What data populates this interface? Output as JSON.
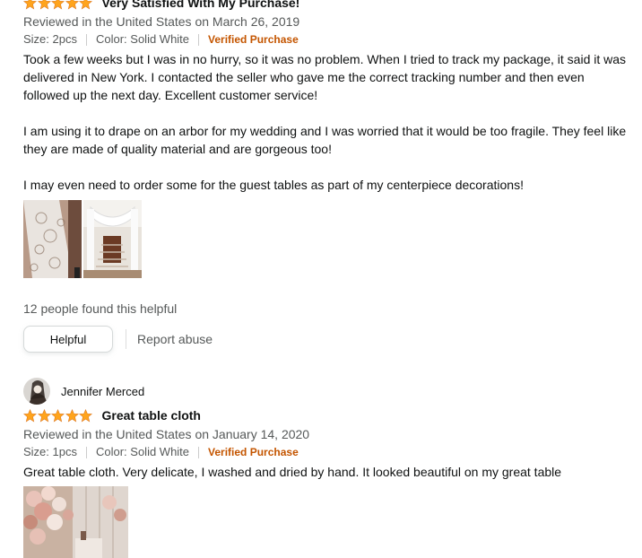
{
  "reviews": [
    {
      "rating": 5,
      "title": "Very Satisfied With My Purchase!",
      "date": "Reviewed in the United States on March 26, 2019",
      "size": "Size: 2pcs",
      "color": "Color: Solid White",
      "verified": "Verified Purchase",
      "body": "Took a few weeks but I was in no hurry, so it was no problem. When I tried to track my package, it said it was delivered in New York. I contacted the seller who gave me the correct tracking number and then even followed up the next day. Excellent customer service!\n\nI am using it to drape on an arbor for my wedding and I was worried that it would be too fragile. They feel like they are made of quality material and are gorgeous too!\n\nI may even need to order some for the guest tables as part of my centerpiece decorations!",
      "helpful_count": "12 people found this helpful",
      "helpful_label": "Helpful",
      "report_label": "Report abuse"
    },
    {
      "reviewer": "Jennifer Merced",
      "rating": 5,
      "title": "Great table cloth",
      "date": "Reviewed in the United States on January 14, 2020",
      "size": "Size: 1pcs",
      "color": "Color: Solid White",
      "verified": "Verified Purchase",
      "body": "Great table cloth. Very delicate, I washed and dried by hand. It looked beautiful on my great table"
    }
  ],
  "colors": {
    "star": "#ffa41c",
    "verified": "#c45500",
    "muted": "#565959"
  }
}
